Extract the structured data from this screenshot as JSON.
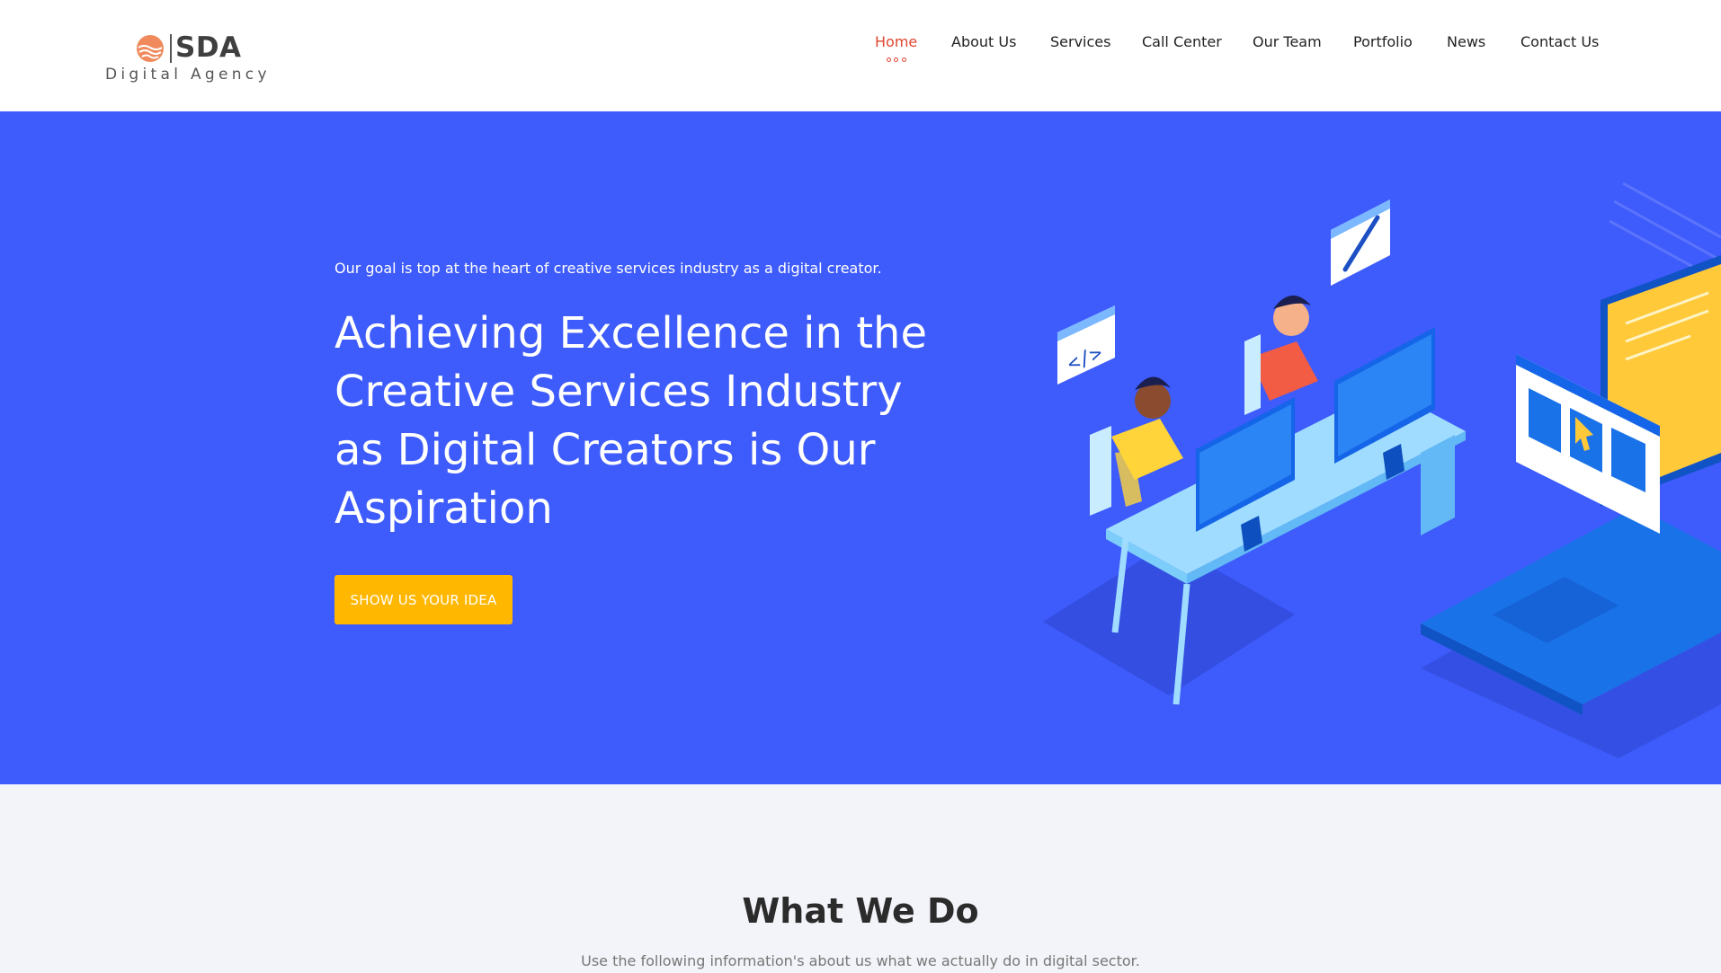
{
  "brand": {
    "name": "SDA",
    "tagline": "Digital Agency",
    "accent": "#e0452f"
  },
  "nav": {
    "items": [
      {
        "label": "Home",
        "active": true
      },
      {
        "label": "About Us"
      },
      {
        "label": "Services"
      },
      {
        "label": "Call Center"
      },
      {
        "label": "Our Team"
      },
      {
        "label": "Portfolio"
      },
      {
        "label": "News"
      },
      {
        "label": "Contact Us"
      }
    ]
  },
  "hero": {
    "kicker": "Our goal is top at the heart of creative services industry as a digital creator.",
    "title": "Achieving Excellence in the Creative Services Industry as Digital Creators is Our Aspiration",
    "cta_label": "SHOW US YOUR IDEA",
    "background": "#3e5bfb",
    "cta_color": "#ffb700",
    "illustration_icon": "developers-at-desk-illustration"
  },
  "what_we_do": {
    "title": "What We Do",
    "subtitle": "Use the following information's about us what we actually do in digital sector."
  }
}
